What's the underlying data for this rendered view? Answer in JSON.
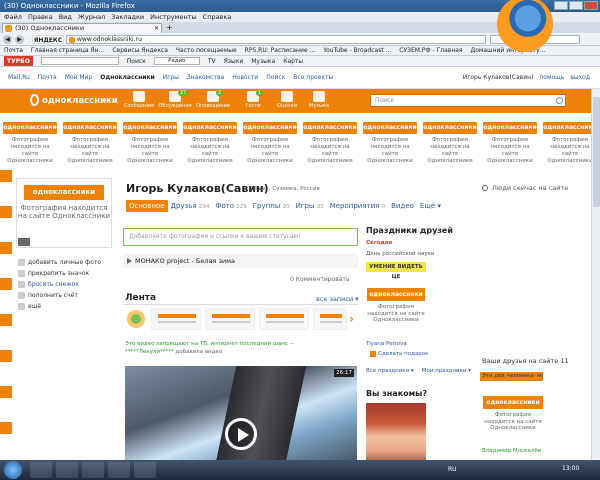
{
  "browser": {
    "window_title": "(30) Одноклассники - Mozilla Firefox",
    "menu": [
      "Файл",
      "Правка",
      "Вид",
      "Журнал",
      "Закладки",
      "Инструменты",
      "Справка"
    ],
    "tab_title": "(30) Одноклассники",
    "new_tab": "+",
    "url": "www.odnoklassniki.ru",
    "yandex_badge": "ЯНДЕКС",
    "bookmarks": [
      "Почта",
      "Главная страница Ян...",
      "Сервисы Яндекса",
      "Часто посещаемые",
      "RP5.RU: Расписание ...",
      "YouTube - Broadcast ...",
      "СУЗЕМ.РФ - Главная",
      "Домашний интернету..."
    ],
    "toolbar": {
      "brand": "ТУРБО",
      "search_button": "Поиск",
      "radio": "Радио",
      "tv": "TV",
      "languages": "Языки",
      "music": "Музыка",
      "maps": "Карты"
    }
  },
  "portal": {
    "links": [
      "Mail.Ru",
      "Почта",
      "Мой Мир",
      "Одноклассники",
      "Игры",
      "Знакомства",
      "Новости",
      "Поиск",
      "Все проекты"
    ],
    "current": "Одноклассники",
    "user_name": "Игорь Кулаков(Савин)",
    "help": "помощь",
    "logout": "выход"
  },
  "header": {
    "logo": "одноклассники",
    "nav": [
      {
        "label": "Сообщения",
        "badge": ""
      },
      {
        "label": "Обсуждения",
        "badge": "27"
      },
      {
        "label": "Оповещения",
        "badge": "2"
      },
      {
        "label": "Гости",
        "badge": "1"
      },
      {
        "label": "Оценки",
        "badge": ""
      },
      {
        "label": "Музыка",
        "badge": ""
      }
    ],
    "search_placeholder": "Поиск"
  },
  "ad_cell": {
    "button": "одноклассники",
    "text": "Фотография находится на сайте Одноклассники"
  },
  "profile": {
    "name": "Игорь Кулаков(Савин)",
    "meta": "38 лет, Суземка, Россия",
    "tabs": [
      {
        "label": "Основное",
        "count": ""
      },
      {
        "label": "Друзья",
        "count": "234"
      },
      {
        "label": "Фото",
        "count": "129"
      },
      {
        "label": "Группы",
        "count": "20"
      },
      {
        "label": "Игры",
        "count": "33"
      },
      {
        "label": "Мероприятия",
        "count": "0"
      },
      {
        "label": "Видео",
        "count": ""
      },
      {
        "label": "Ещё",
        "count": ""
      }
    ],
    "avatar_button": "одноклассники",
    "avatar_text": "Фотография находится на сайте Одноклассники"
  },
  "left_links": [
    "добавить личные фото",
    "прикрепить значок",
    "бросить снежок",
    "пополнить счёт",
    "ещё"
  ],
  "status": {
    "placeholder": "Добавляйте фотографии и ссылки к вашим статусам!",
    "music": "МОНАКО project - Белая зима",
    "comments": "0 Комментировать"
  },
  "feed": {
    "title": "Лента",
    "filter": "все записи",
    "post_title": "Это видео запрещают на ТВ, интернет последний шанс --",
    "post_author": "*****Лекули*****",
    "post_action": " добавила видео",
    "duration": "26:17"
  },
  "holidays": {
    "title": "Праздники друзей",
    "today": "Сегодня",
    "name": "День российской науки",
    "button": "УМЕНИЕ ВИДЕТЬ ЦЕ",
    "gift_button": "одноклассники",
    "gift_text": "Фотография находится на сайте Одноклассники",
    "gift_user": "Tiyana Petrova",
    "gift_link": "Сделать подарок",
    "more_holidays": "Все праздники",
    "my_holidays": "Мои праздники",
    "meet_title": "Вы знакомы?"
  },
  "right": {
    "online_title": "Люди сейчас на сайте",
    "friends_title": "Ваши друзья на сайте",
    "friends_count": "11",
    "friends_bar": "Эти два человека- мо",
    "friend_button": "одноклассники",
    "friend_text": "Фотография находится на сайте Одноклассники",
    "friend_name": "Владимир Москалёв"
  },
  "taskbar": {
    "lang": "RU",
    "time": "13:00"
  },
  "colors": {
    "accent": "#ee8208",
    "link": "#2b5c9e",
    "green": "#2b9a2a"
  }
}
